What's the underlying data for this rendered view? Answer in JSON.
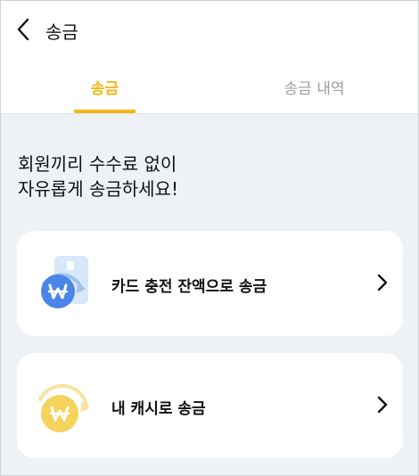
{
  "header": {
    "title": "송금",
    "back_icon": "chevron-left-icon"
  },
  "tabs": [
    {
      "label": "송금",
      "active": true
    },
    {
      "label": "송금 내역",
      "active": false
    }
  ],
  "headline": {
    "line1": "회원끼리 수수료 없이",
    "line2": "자유롭게 송금하세요!"
  },
  "options": [
    {
      "label": "카드 충전 잔액으로 송금",
      "icon": "card-won-transfer-icon"
    },
    {
      "label": "내 캐시로 송금",
      "icon": "coin-won-transfer-icon"
    }
  ],
  "colors": {
    "accent": "#f1b716",
    "background": "#eef2f7",
    "inactive_tab": "#9a9ea5",
    "won_blue": "#4a86e8",
    "card_light_blue": "#d7e8fb",
    "coin_yellow": "#f6d35c"
  }
}
